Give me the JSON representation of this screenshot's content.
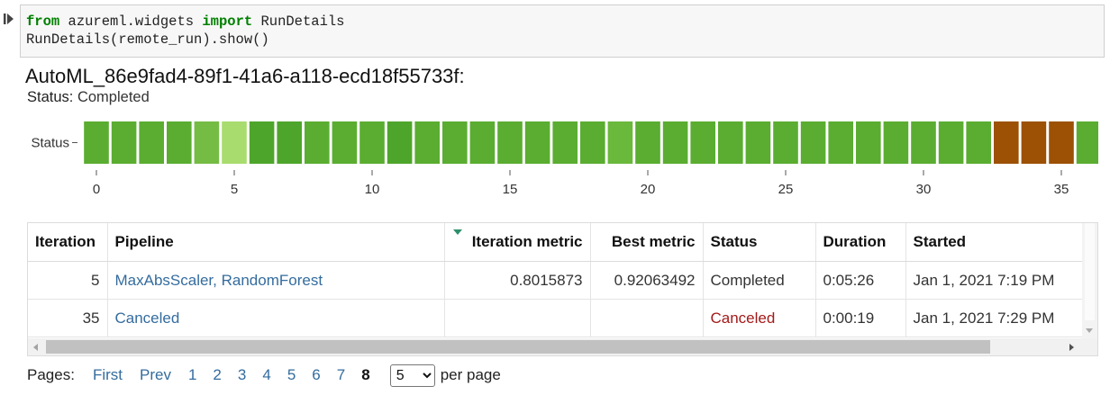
{
  "code": {
    "line1": {
      "kw_from": "from",
      "module": " azureml.widgets ",
      "kw_import": "import",
      "name": " RunDetails"
    },
    "line2": "RunDetails(remote_run).show()"
  },
  "run": {
    "title": "AutoML_86e9fad4-89f1-41a6-a118-ecd18f55733f:",
    "status_label": "Status:",
    "status_value": "Completed"
  },
  "chart_data": {
    "type": "heatmap",
    "ylabel": "Status",
    "x_ticks": [
      0,
      5,
      10,
      15,
      20,
      25,
      30,
      35
    ],
    "xlim": [
      -0.5,
      36.5
    ],
    "cells": [
      {
        "iteration": 0,
        "color": "#5aad31"
      },
      {
        "iteration": 1,
        "color": "#5aad31"
      },
      {
        "iteration": 2,
        "color": "#5aad31"
      },
      {
        "iteration": 3,
        "color": "#5aad31"
      },
      {
        "iteration": 4,
        "color": "#75bc45"
      },
      {
        "iteration": 5,
        "color": "#a8dc6e"
      },
      {
        "iteration": 6,
        "color": "#4ea52b"
      },
      {
        "iteration": 7,
        "color": "#4ea52b"
      },
      {
        "iteration": 8,
        "color": "#5aad31"
      },
      {
        "iteration": 9,
        "color": "#5aad31"
      },
      {
        "iteration": 10,
        "color": "#5aad31"
      },
      {
        "iteration": 11,
        "color": "#4ea52b"
      },
      {
        "iteration": 12,
        "color": "#5aad31"
      },
      {
        "iteration": 13,
        "color": "#5aad31"
      },
      {
        "iteration": 14,
        "color": "#5aad31"
      },
      {
        "iteration": 15,
        "color": "#5aad31"
      },
      {
        "iteration": 16,
        "color": "#5aad31"
      },
      {
        "iteration": 17,
        "color": "#5aad31"
      },
      {
        "iteration": 18,
        "color": "#5aad31"
      },
      {
        "iteration": 19,
        "color": "#6ab83c"
      },
      {
        "iteration": 20,
        "color": "#5aad31"
      },
      {
        "iteration": 21,
        "color": "#5aad31"
      },
      {
        "iteration": 22,
        "color": "#5aad31"
      },
      {
        "iteration": 23,
        "color": "#5aad31"
      },
      {
        "iteration": 24,
        "color": "#5aad31"
      },
      {
        "iteration": 25,
        "color": "#5aad31"
      },
      {
        "iteration": 26,
        "color": "#5aad31"
      },
      {
        "iteration": 27,
        "color": "#5aad31"
      },
      {
        "iteration": 28,
        "color": "#5aad31"
      },
      {
        "iteration": 29,
        "color": "#5aad31"
      },
      {
        "iteration": 30,
        "color": "#5aad31"
      },
      {
        "iteration": 31,
        "color": "#5aad31"
      },
      {
        "iteration": 32,
        "color": "#5aad31"
      },
      {
        "iteration": 33,
        "color": "#9c5104"
      },
      {
        "iteration": 34,
        "color": "#9c5104"
      },
      {
        "iteration": 35,
        "color": "#9c5104"
      },
      {
        "iteration": 36,
        "color": "#5aad31"
      }
    ]
  },
  "table": {
    "columns": [
      "Iteration",
      "Pipeline",
      "Iteration metric",
      "Best metric",
      "Status",
      "Duration",
      "Started"
    ],
    "rows": [
      {
        "iteration": "5",
        "pipeline": "MaxAbsScaler, RandomForest",
        "iteration_metric": "0.8015873",
        "best_metric": "0.92063492",
        "status": "Completed",
        "duration": "0:05:26",
        "started": "Jan 1, 2021 7:19 PM"
      },
      {
        "iteration": "35",
        "pipeline": "Canceled",
        "iteration_metric": "",
        "best_metric": "",
        "status": "Canceled",
        "duration": "0:00:19",
        "started": "Jan 1, 2021 7:29 PM"
      }
    ]
  },
  "pager": {
    "label": "Pages:",
    "first": "First",
    "prev": "Prev",
    "pages": [
      "1",
      "2",
      "3",
      "4",
      "5",
      "6",
      "7"
    ],
    "current": "8",
    "per_page_value": "5",
    "per_page_suffix": "per page"
  },
  "colors": {
    "link": "#346c9e",
    "canceled_text": "#a31a1a",
    "sort_indicator": "#2d8f6a"
  }
}
